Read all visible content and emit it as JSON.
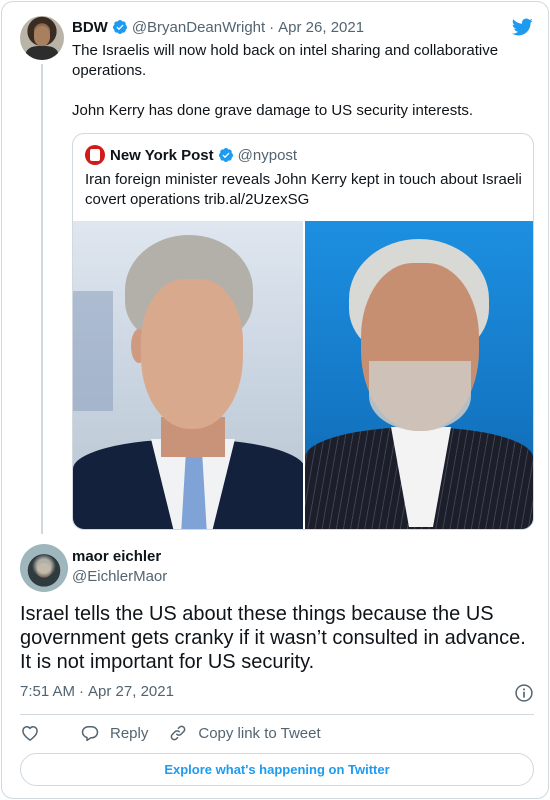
{
  "parent_tweet": {
    "author_name": "BDW",
    "author_handle": "@BryanDeanWright",
    "separator": "·",
    "date": "Apr 26, 2021",
    "text_line_1": "The Israelis will now hold back on intel sharing and collaborative operations.",
    "text_line_2": "John Kerry has done grave damage to US security interests."
  },
  "quoted_tweet": {
    "author_name": "New York Post",
    "author_handle": "@nypost",
    "text": "Iran foreign minister reveals John Kerry kept in touch about Israeli covert operations trib.al/2UzexSG"
  },
  "reply_tweet": {
    "author_name": "maor eichler",
    "author_handle": "@EichlerMaor",
    "text": "Israel tells the US about these things because the US government gets cranky if it wasn’t consulted in advance. It is not important for US security.",
    "time": "7:51 AM",
    "separator": "·",
    "date": "Apr 27, 2021"
  },
  "actions": {
    "reply_label": "Reply",
    "copy_link_label": "Copy link to Tweet"
  },
  "explore_label": "Explore what's happening on Twitter",
  "icons": {
    "verified": "verified-badge-icon",
    "logo": "twitter-bird-icon",
    "info": "info-icon",
    "like": "heart-icon",
    "reply": "reply-bubble-icon",
    "copy_link": "link-icon"
  },
  "colors": {
    "accent": "#1d9bf0",
    "text_primary": "#0f1419",
    "text_secondary": "#536471",
    "border": "#cfd9de",
    "nypost_red": "#d11a1a"
  }
}
